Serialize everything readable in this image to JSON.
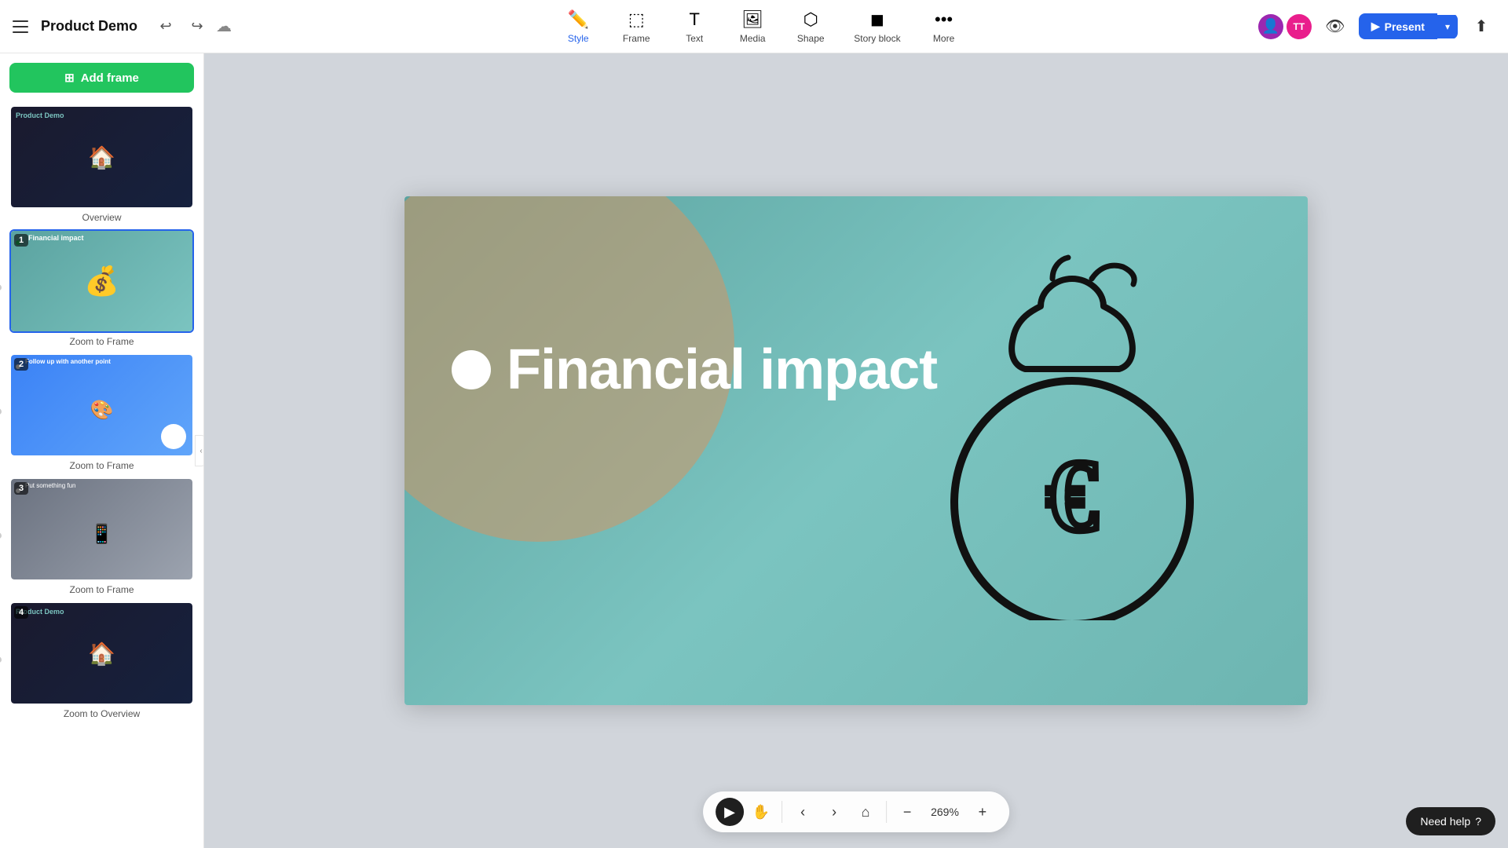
{
  "app": {
    "title": "Product Demo",
    "hamburger_label": "Menu"
  },
  "toolbar": {
    "style_label": "Style",
    "frame_label": "Frame",
    "text_label": "Text",
    "media_label": "Media",
    "shape_label": "Shape",
    "storyblock_label": "Story block",
    "more_label": "More",
    "present_label": "Present"
  },
  "sidebar": {
    "add_frame_label": "Add frame",
    "slides": [
      {
        "id": 0,
        "label": "Overview",
        "type": "overview"
      },
      {
        "id": 1,
        "number": "1",
        "label": "Zoom to Frame",
        "title": "Financial impact",
        "type": "financial"
      },
      {
        "id": 2,
        "number": "2",
        "label": "Zoom to Frame",
        "title": "Follow up with another point",
        "type": "followup"
      },
      {
        "id": 3,
        "number": "3",
        "label": "Zoom to Frame",
        "title": "Put something fun",
        "type": "fun"
      },
      {
        "id": 4,
        "number": "4",
        "label": "Zoom to Overview",
        "type": "productdemo"
      }
    ]
  },
  "canvas": {
    "slide_title": "Financial impact",
    "zoom_level": "269%"
  },
  "bottom_nav": {
    "play_label": "Play",
    "hand_label": "Hand",
    "prev_label": "Previous",
    "next_label": "Next",
    "home_label": "Home",
    "zoom_out_label": "Zoom out",
    "zoom_in_label": "Zoom in",
    "zoom_display": "269%"
  },
  "help": {
    "label": "Need help",
    "icon": "?"
  }
}
